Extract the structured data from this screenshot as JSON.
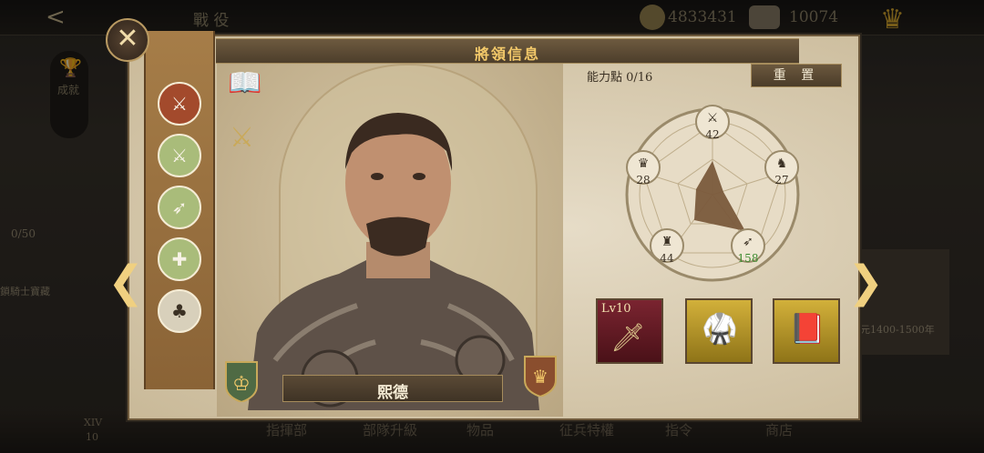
{
  "topbar": {
    "back_label": "<",
    "title": "戰 役",
    "gold": "4833431",
    "honor": "10074"
  },
  "left_hud": {
    "achievements_label": "成就",
    "progress": "0/50",
    "progress_label": "鎖騎士寶藏"
  },
  "right_hud": {
    "era_label": "元1400-1500年"
  },
  "bottom": {
    "tabs": [
      "指揮部",
      "部隊升級",
      "物品",
      "征兵特權",
      "指令",
      "商店"
    ],
    "counter_top": "XIV",
    "counter_bottom": "10"
  },
  "panel": {
    "title": "將領信息",
    "points_label": "能力點 0/16",
    "reset_label": "重 置",
    "general_name": "熙德"
  },
  "sidebar": {
    "icons": [
      "sword-spear-icon",
      "crossed-swords-icon",
      "bow-icon",
      "crossbow-icon",
      "forest-terrain-icon"
    ]
  },
  "stats": {
    "attack": "42",
    "royal": "28",
    "cavalry": "27",
    "infantry": "44",
    "ranged": "158"
  },
  "items": {
    "weapon_level": "Lv10"
  },
  "colors": {
    "accent": "#f3c96a",
    "panel": "#d9ccb3",
    "radar_fill": "#7a5a3c",
    "stat_highlight": "#3c8a2e"
  }
}
